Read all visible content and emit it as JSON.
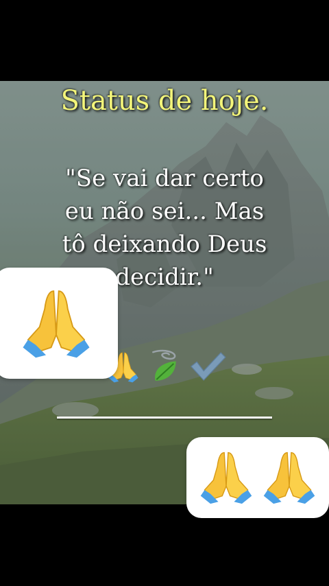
{
  "status_title": "Status de hoje.",
  "quote_lines": [
    "\"Se vai dar certo",
    "eu não sei... Mas",
    "tô deixando Deus",
    "decidir.\""
  ],
  "emoji_icons": [
    "praying-hands",
    "leaf-fluttering-in-wind",
    "check-mark"
  ],
  "stickers": {
    "left": [
      "praying-hands"
    ],
    "right": [
      "praying-hands",
      "praying-hands"
    ]
  },
  "colors": {
    "title": "#f3f57a",
    "text": "#ffffff",
    "letterbox": "#000000"
  }
}
